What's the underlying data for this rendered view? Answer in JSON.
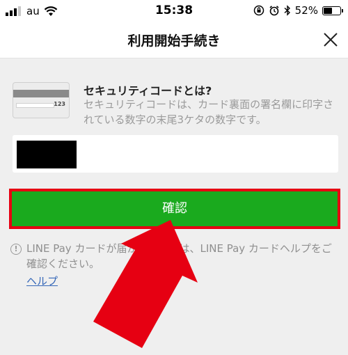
{
  "status_bar": {
    "carrier": "au",
    "time": "15:38",
    "battery_percent": "52%",
    "battery_level": 0.52
  },
  "header": {
    "title": "利用開始手続き"
  },
  "security_info": {
    "title": "セキュリティコードとは?",
    "description": "セキュリティコードは、カード裏面の署名欄に印字されている数字の末尾3ケタの数字です。",
    "card_code": "123"
  },
  "security_code_input": {
    "value": ""
  },
  "confirm_button": {
    "label": "確認"
  },
  "help": {
    "text": "LINE Pay カードが届かない場合は、LINE Pay カードヘルプをご確認ください。",
    "link_label": "ヘルプ"
  },
  "colors": {
    "confirm_green": "#1aaa1e",
    "highlight_red": "#e60012",
    "link_blue": "#3567b8"
  }
}
